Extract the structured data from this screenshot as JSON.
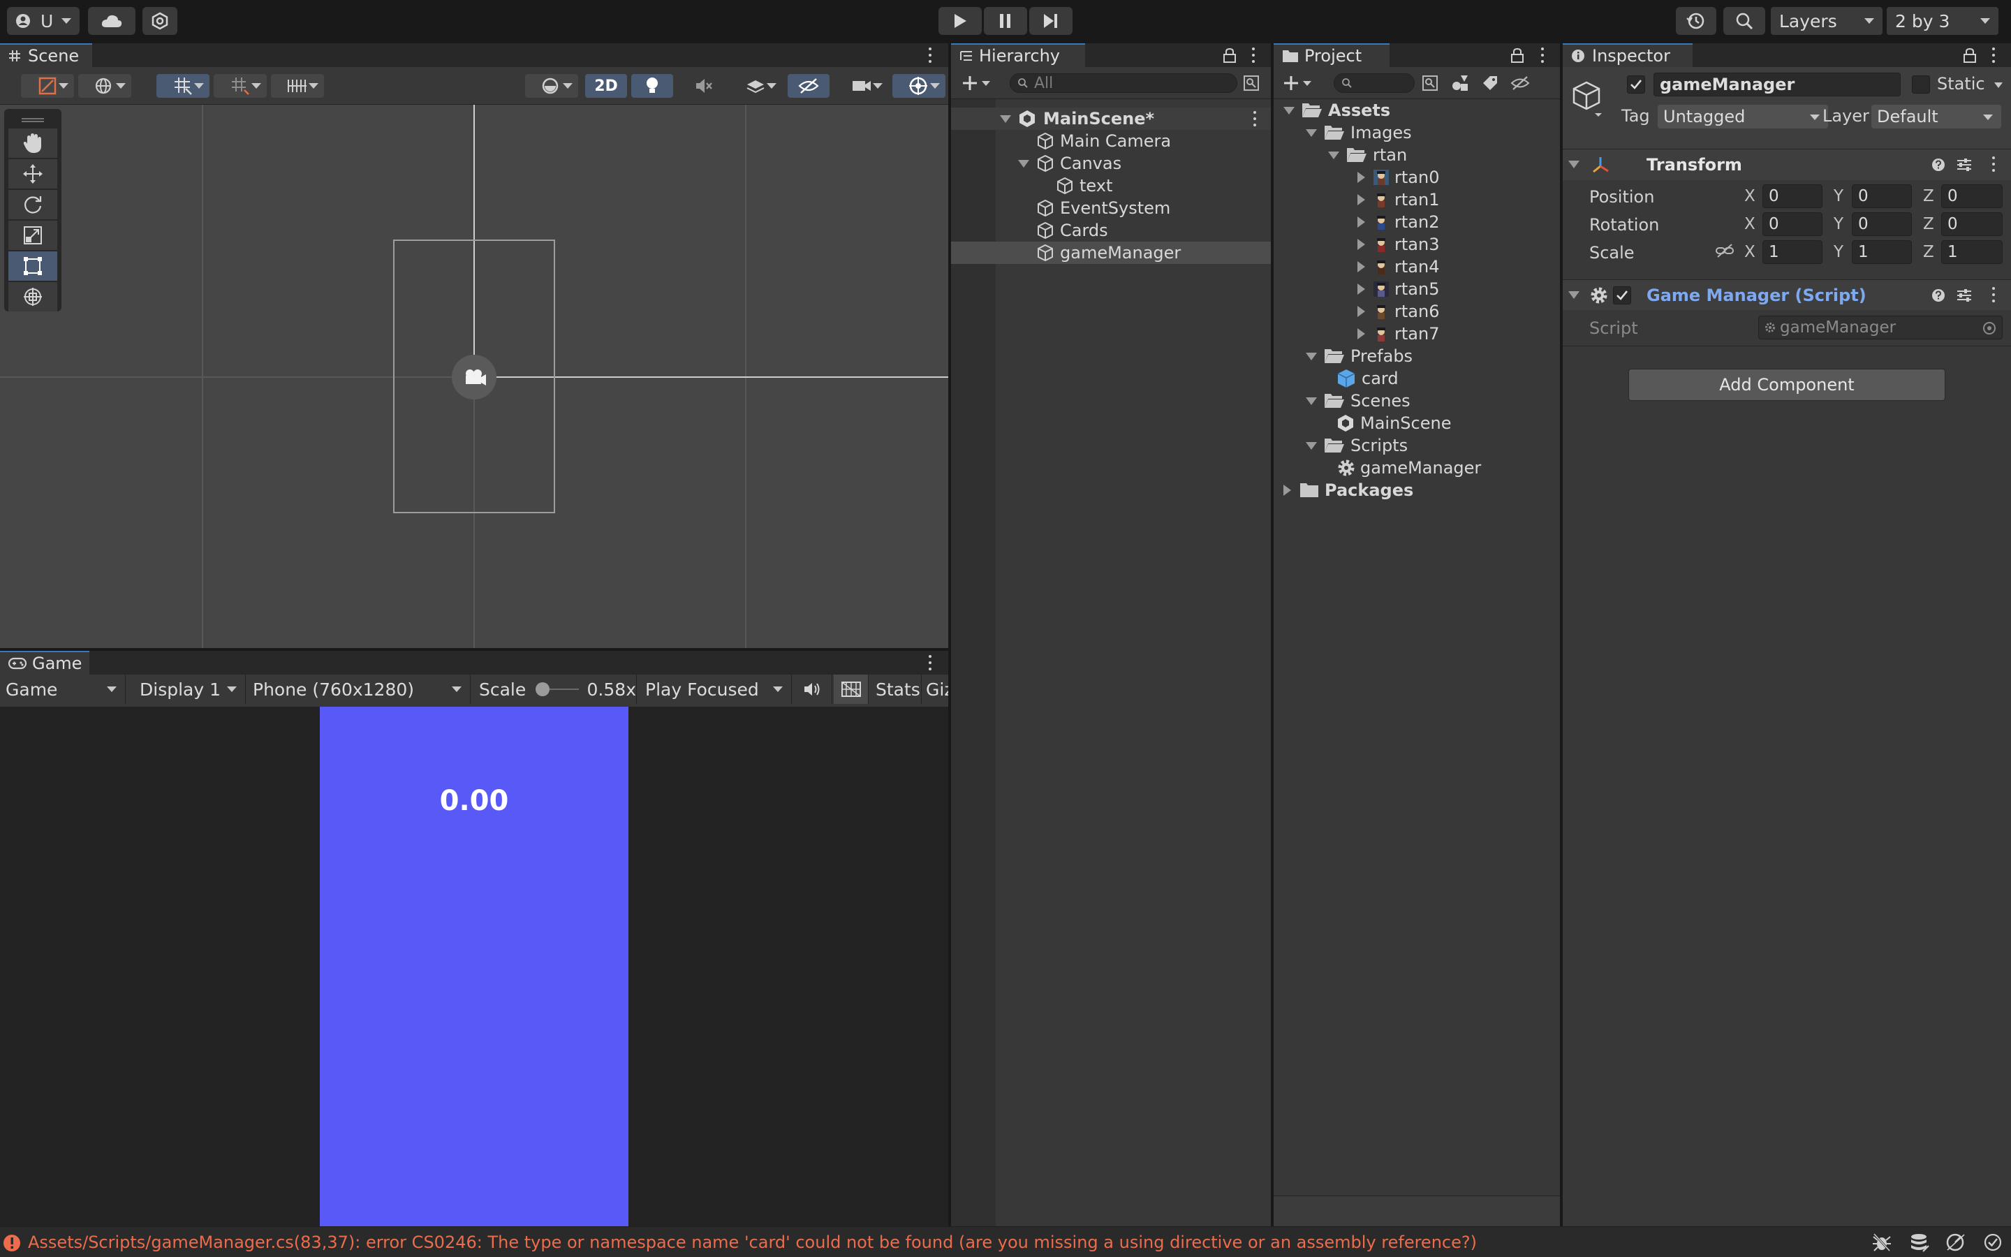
{
  "toolbar": {
    "account_label": "U",
    "layers_label": "Layers",
    "layout_label": "2 by 3"
  },
  "scene": {
    "tab_label": "Scene",
    "mode_2d_label": "2D"
  },
  "game": {
    "tab_label": "Game",
    "view_dropdown": "Game",
    "display_dropdown": "Display 1",
    "resolution_dropdown": "Phone (760x1280)",
    "scale_label": "Scale",
    "scale_value": "0.58x",
    "play_mode_dropdown": "Play Focused",
    "stats_label": "Stats",
    "gizmos_label": "Giz",
    "timer_text": "0.00",
    "canvas_color": "#5959f7"
  },
  "hierarchy": {
    "tab_label": "Hierarchy",
    "search_placeholder": "All",
    "items": [
      {
        "label": "MainScene*"
      },
      {
        "label": "Main Camera"
      },
      {
        "label": "Canvas"
      },
      {
        "label": "text"
      },
      {
        "label": "EventSystem"
      },
      {
        "label": "Cards"
      },
      {
        "label": "gameManager"
      }
    ]
  },
  "project": {
    "tab_label": "Project",
    "items": [
      {
        "label": "Assets"
      },
      {
        "label": "Images"
      },
      {
        "label": "rtan"
      },
      {
        "label": "rtan0"
      },
      {
        "label": "rtan1"
      },
      {
        "label": "rtan2"
      },
      {
        "label": "rtan3"
      },
      {
        "label": "rtan4"
      },
      {
        "label": "rtan5"
      },
      {
        "label": "rtan6"
      },
      {
        "label": "rtan7"
      },
      {
        "label": "Prefabs"
      },
      {
        "label": "card"
      },
      {
        "label": "Scenes"
      },
      {
        "label": "MainScene"
      },
      {
        "label": "Scripts"
      },
      {
        "label": "gameManager"
      },
      {
        "label": "Packages"
      }
    ]
  },
  "inspector": {
    "tab_label": "Inspector",
    "object_name": "gameManager",
    "static_label": "Static",
    "tag_label": "Tag",
    "tag_value": "Untagged",
    "layer_label": "Layer",
    "layer_value": "Default",
    "transform": {
      "title": "Transform",
      "position_label": "Position",
      "rotation_label": "Rotation",
      "scale_label": "Scale",
      "x": "X",
      "y": "Y",
      "z": "Z",
      "position": [
        "0",
        "0",
        "0"
      ],
      "rotation": [
        "0",
        "0",
        "0"
      ],
      "scale": [
        "1",
        "1",
        "1"
      ]
    },
    "script_component": {
      "title": "Game Manager (Script)",
      "script_label": "Script",
      "script_value": "gameManager"
    },
    "add_component_label": "Add Component"
  },
  "console": {
    "error_message": "Assets/Scripts/gameManager.cs(83,37): error CS0246: The type or namespace name 'card' could not be found (are you missing a using directive or an assembly reference?)",
    "error_color": "#ec6c4c"
  },
  "colors": {
    "accent": "#3a79bb",
    "script_title": "#7ea9f0"
  }
}
